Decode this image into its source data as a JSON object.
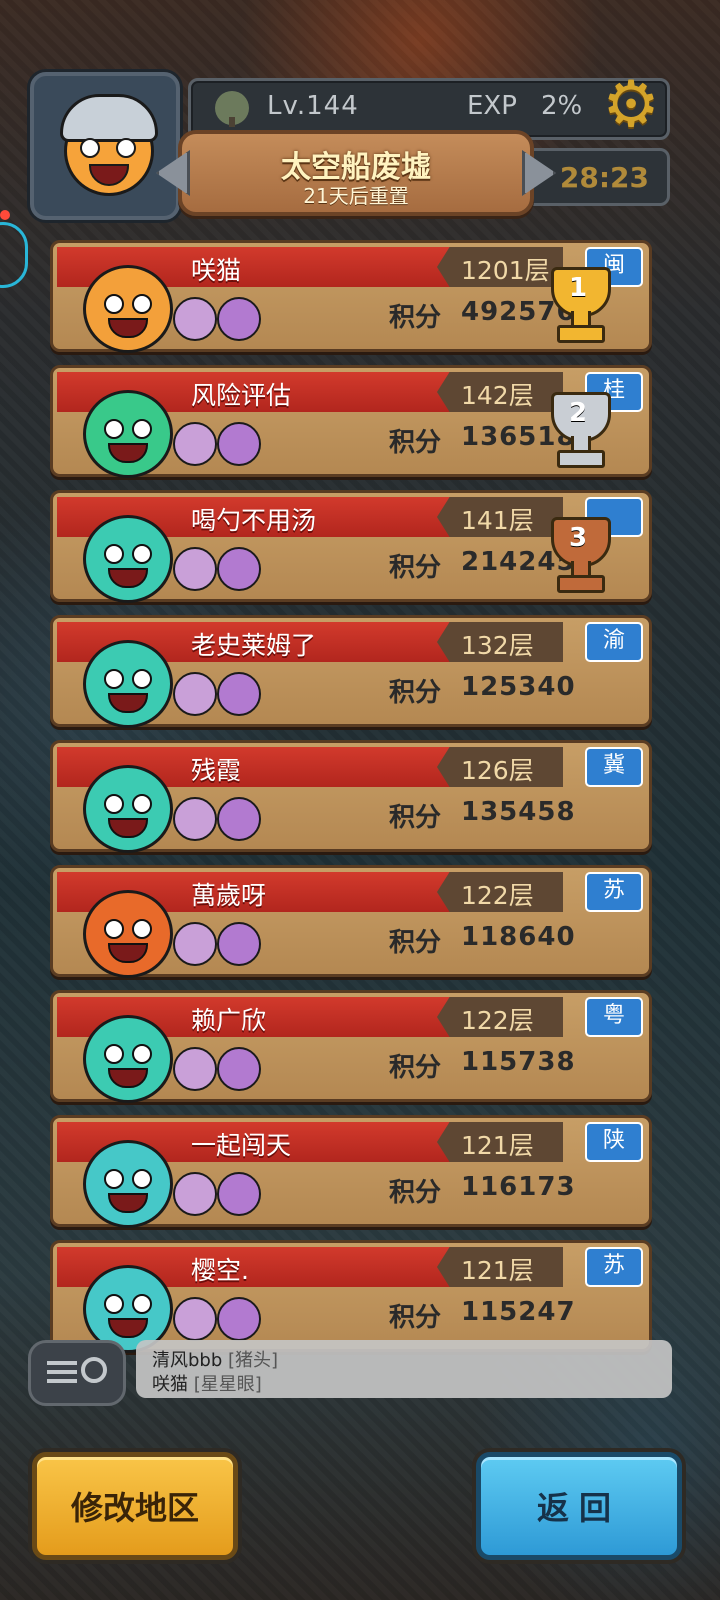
{
  "header": {
    "level": "Lv.144",
    "exp_label": "EXP",
    "exp_value": "2%",
    "area_name": "太空船废墟",
    "reset_text": "21天后重置",
    "timer": "28:23",
    "icons": {
      "level": "tree-icon",
      "settings": "gear-icon"
    }
  },
  "ranking": {
    "score_label": "积分",
    "rows": [
      {
        "name": "咲猫",
        "floor": "1201层",
        "region": "闽",
        "score": "492576",
        "trophy": "1",
        "trophy_color": "#f2b630",
        "pet_color": "#f3a03a"
      },
      {
        "name": "风险评估",
        "floor": "142层",
        "region": "桂",
        "score": "136518",
        "trophy": "2",
        "trophy_color": "#c9ced4",
        "pet_color": "#39c98a"
      },
      {
        "name": "喝勺不用汤",
        "floor": "141层",
        "region": "",
        "score": "214245",
        "trophy": "3",
        "trophy_color": "#c06a3a",
        "pet_color": "#3ccbb2"
      },
      {
        "name": "老史莱姆了",
        "floor": "132层",
        "region": "渝",
        "score": "125340",
        "pet_color": "#3ccbb2"
      },
      {
        "name": "残霞",
        "floor": "126层",
        "region": "冀",
        "score": "135458",
        "pet_color": "#3ccbb2"
      },
      {
        "name": "萬歲呀",
        "floor": "122层",
        "region": "苏",
        "score": "118640",
        "pet_color": "#e86a2a"
      },
      {
        "name": "赖广欣",
        "floor": "122层",
        "region": "粤",
        "score": "115738",
        "pet_color": "#3ccbb2"
      },
      {
        "name": "一起闯天",
        "floor": "121层",
        "region": "陕",
        "score": "116173",
        "pet_color": "#46c8c8"
      },
      {
        "name": "樱空.",
        "floor": "121层",
        "region": "苏",
        "score": "115247",
        "pet_color": "#46c8c8"
      }
    ]
  },
  "chat": {
    "line1_user": "清风bbb",
    "line1_tag": "[猪头]",
    "line2_user": "咲猫",
    "line2_tag": "[星星眼]"
  },
  "buttons": {
    "change_region": "修改地区",
    "back": "返回"
  }
}
